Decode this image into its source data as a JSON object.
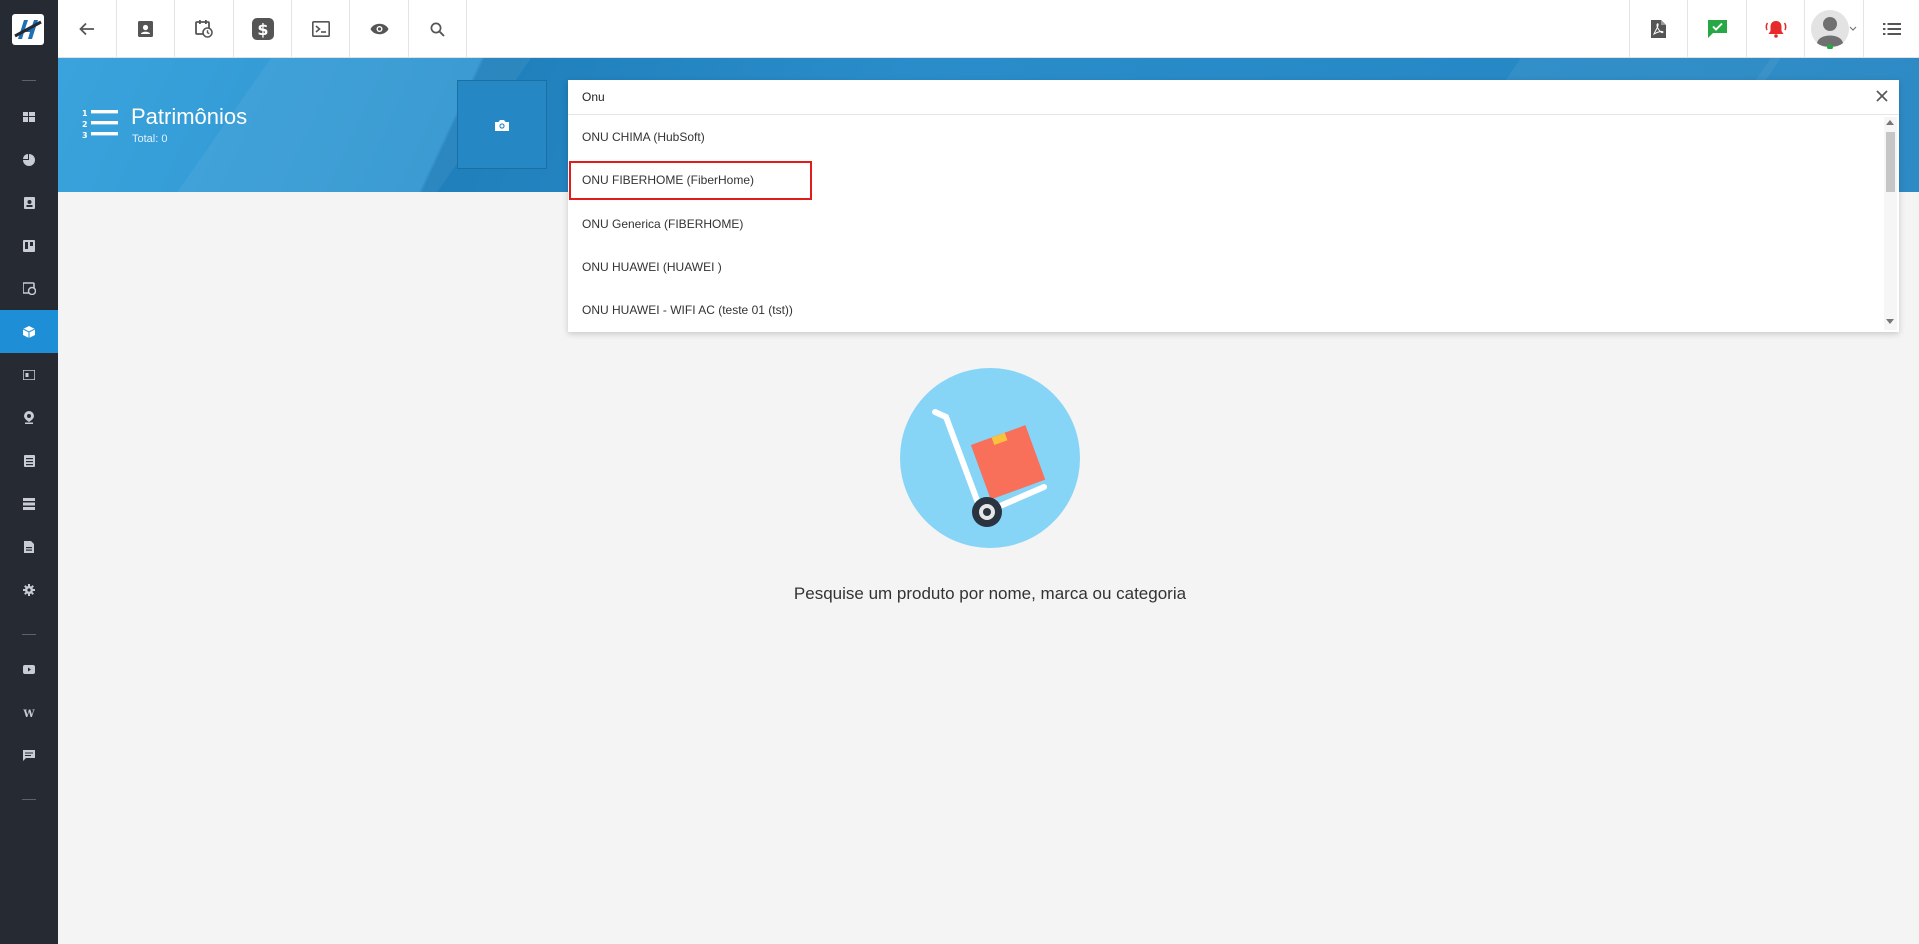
{
  "sidebar": {
    "logo": "hubsoft-logo",
    "items": [
      {
        "icon": "dashboard-icon"
      },
      {
        "icon": "pie-chart-icon"
      },
      {
        "icon": "contact-card-icon"
      },
      {
        "icon": "kanban-board-icon"
      },
      {
        "icon": "calendar-clock-icon"
      },
      {
        "icon": "box-icon",
        "active": true
      },
      {
        "icon": "id-card-icon"
      },
      {
        "icon": "map-pin-icon"
      },
      {
        "icon": "list-document-icon"
      },
      {
        "icon": "server-icon"
      },
      {
        "icon": "file-icon"
      },
      {
        "icon": "gear-icon"
      },
      {
        "icon": "youtube-icon"
      },
      {
        "icon": "wiki-icon"
      },
      {
        "icon": "chat-icon"
      }
    ],
    "active_color": "#1e8fd6",
    "bg_color": "#262a32"
  },
  "topbar": {
    "left_buttons": [
      "back-arrow-icon",
      "contact-card-icon",
      "calendar-clock-icon",
      "dollar-icon",
      "terminal-icon",
      "eye-icon",
      "search-icon"
    ],
    "right_buttons": [
      "pdf-icon",
      "chat-check-icon",
      "alarm-bell-icon",
      "user-avatar",
      "list-menu-icon"
    ],
    "check_color": "#27a844",
    "alarm_color": "#e52b2b"
  },
  "header": {
    "title": "Patrimônios",
    "subtitle": "Total: 0",
    "band_color": "#2384c1"
  },
  "search": {
    "value": "Onu",
    "options": [
      "ONU CHIMA (HubSoft)",
      "ONU FIBERHOME (FiberHome)",
      "ONU Generica (FIBERHOME)",
      "ONU HUAWEI (HUAWEI )",
      "ONU HUAWEI - WIFI AC (teste 01 (tst))"
    ],
    "highlighted_option": "ONU FIBERHOME (FiberHome)",
    "highlight_color": "#e21b1b"
  },
  "empty_state": {
    "icon": "hand-truck-box-illustration",
    "message": "Pesquise um produto por nome, marca ou categoria"
  }
}
